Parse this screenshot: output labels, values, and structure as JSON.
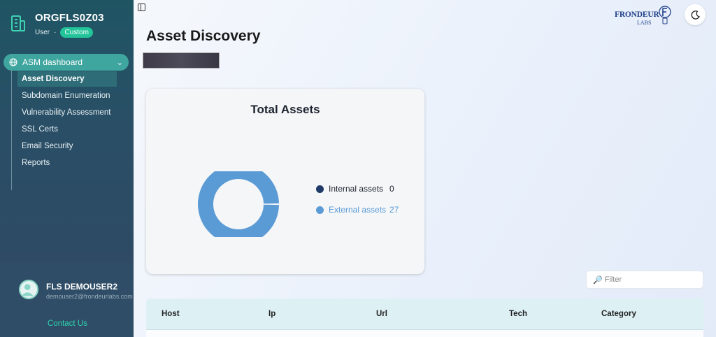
{
  "org": {
    "name": "ORGFLS0Z03",
    "role": "User",
    "separator": "·",
    "badge": "Custom"
  },
  "nav": {
    "main": {
      "label": "ASM dashboard"
    },
    "items": [
      {
        "label": "Asset Discovery",
        "active": true
      },
      {
        "label": "Subdomain Enumeration"
      },
      {
        "label": "Vulnerability Assessment"
      },
      {
        "label": "SSL Certs"
      },
      {
        "label": "Email Security"
      },
      {
        "label": "Reports"
      }
    ]
  },
  "user": {
    "name": "FLS DEMOUSER2",
    "email": "demouser2@frondeurlabs.com",
    "contact": "Contact Us"
  },
  "header": {
    "logo_text": "FRONDEUR",
    "logo_sub": "LABS",
    "theme_icon": "moon-icon"
  },
  "page": {
    "title": "Asset Discovery"
  },
  "card": {
    "title": "Total Assets",
    "legend": [
      {
        "label": "Internal assets",
        "value": "0",
        "color": "#1f3a68"
      },
      {
        "label": "External assets",
        "value": "27",
        "color": "#5b9bd5"
      }
    ]
  },
  "chart_data": {
    "type": "pie",
    "title": "Total Assets",
    "categories": [
      "Internal assets",
      "External assets"
    ],
    "values": [
      0,
      27
    ],
    "colors": [
      "#1f3a68",
      "#5b9bd5"
    ],
    "legend": "right"
  },
  "filter": {
    "placeholder": "Filter"
  },
  "table": {
    "columns": [
      "Host",
      "Ip",
      "Url",
      "Tech",
      "Category"
    ]
  }
}
